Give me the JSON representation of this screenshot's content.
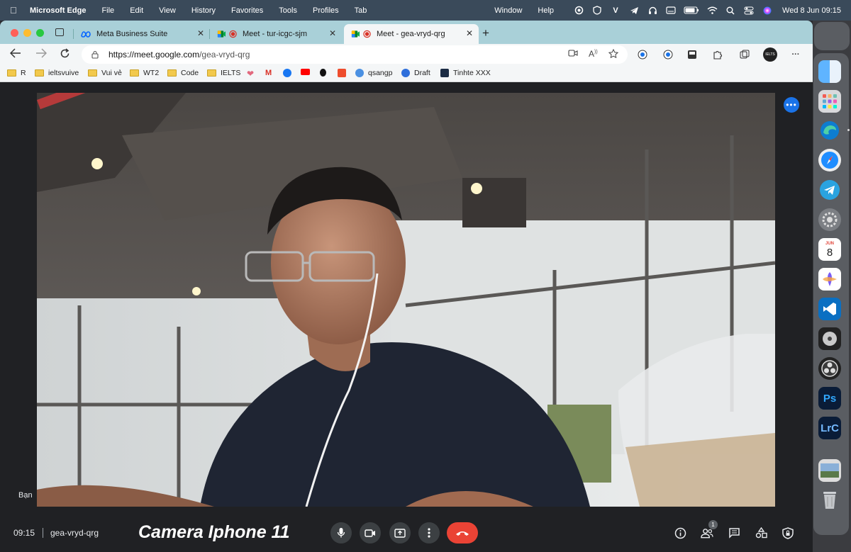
{
  "menubar": {
    "app_name": "Microsoft Edge",
    "menus": [
      "File",
      "Edit",
      "View",
      "History",
      "Favorites",
      "Tools",
      "Profiles",
      "Tab"
    ],
    "right_menus": [
      "Window",
      "Help"
    ],
    "clock": "Wed 8 Jun  09:15"
  },
  "browser": {
    "tabs": [
      {
        "title": "Meta Business Suite",
        "icon": "meta-icon"
      },
      {
        "title": "Meet - tur-icgc-sjm",
        "icon": "meet-icon"
      },
      {
        "title": "Meet - gea-vryd-qrg",
        "icon": "meet-icon",
        "active": true
      }
    ],
    "url": {
      "origin": "https://meet.google.com",
      "path": "/gea-vryd-qrg"
    },
    "bookmarks": [
      {
        "label": "R",
        "icon": "folder-icon"
      },
      {
        "label": "ieltsvuive",
        "icon": "folder-icon"
      },
      {
        "label": "Vui vẻ",
        "icon": "folder-icon"
      },
      {
        "label": "WT2",
        "icon": "folder-icon"
      },
      {
        "label": "Code",
        "icon": "folder-icon"
      },
      {
        "label": "IELTS",
        "icon": "folder-icon"
      },
      {
        "label": "qsangp",
        "icon": "profile-icon"
      },
      {
        "label": "Draft",
        "icon": "react-icon"
      },
      {
        "label": "Tinhte XXX",
        "icon": "tinhte-icon"
      }
    ]
  },
  "meet": {
    "self_label": "Bạn",
    "time": "09:15",
    "meeting_code": "gea-vryd-qrg",
    "caption": "Camera Iphone 11",
    "participants_count": "1"
  },
  "colors": {
    "tabstrip": "#a9d0d8",
    "hangup": "#ea4335",
    "accent": "#1a73e8"
  }
}
